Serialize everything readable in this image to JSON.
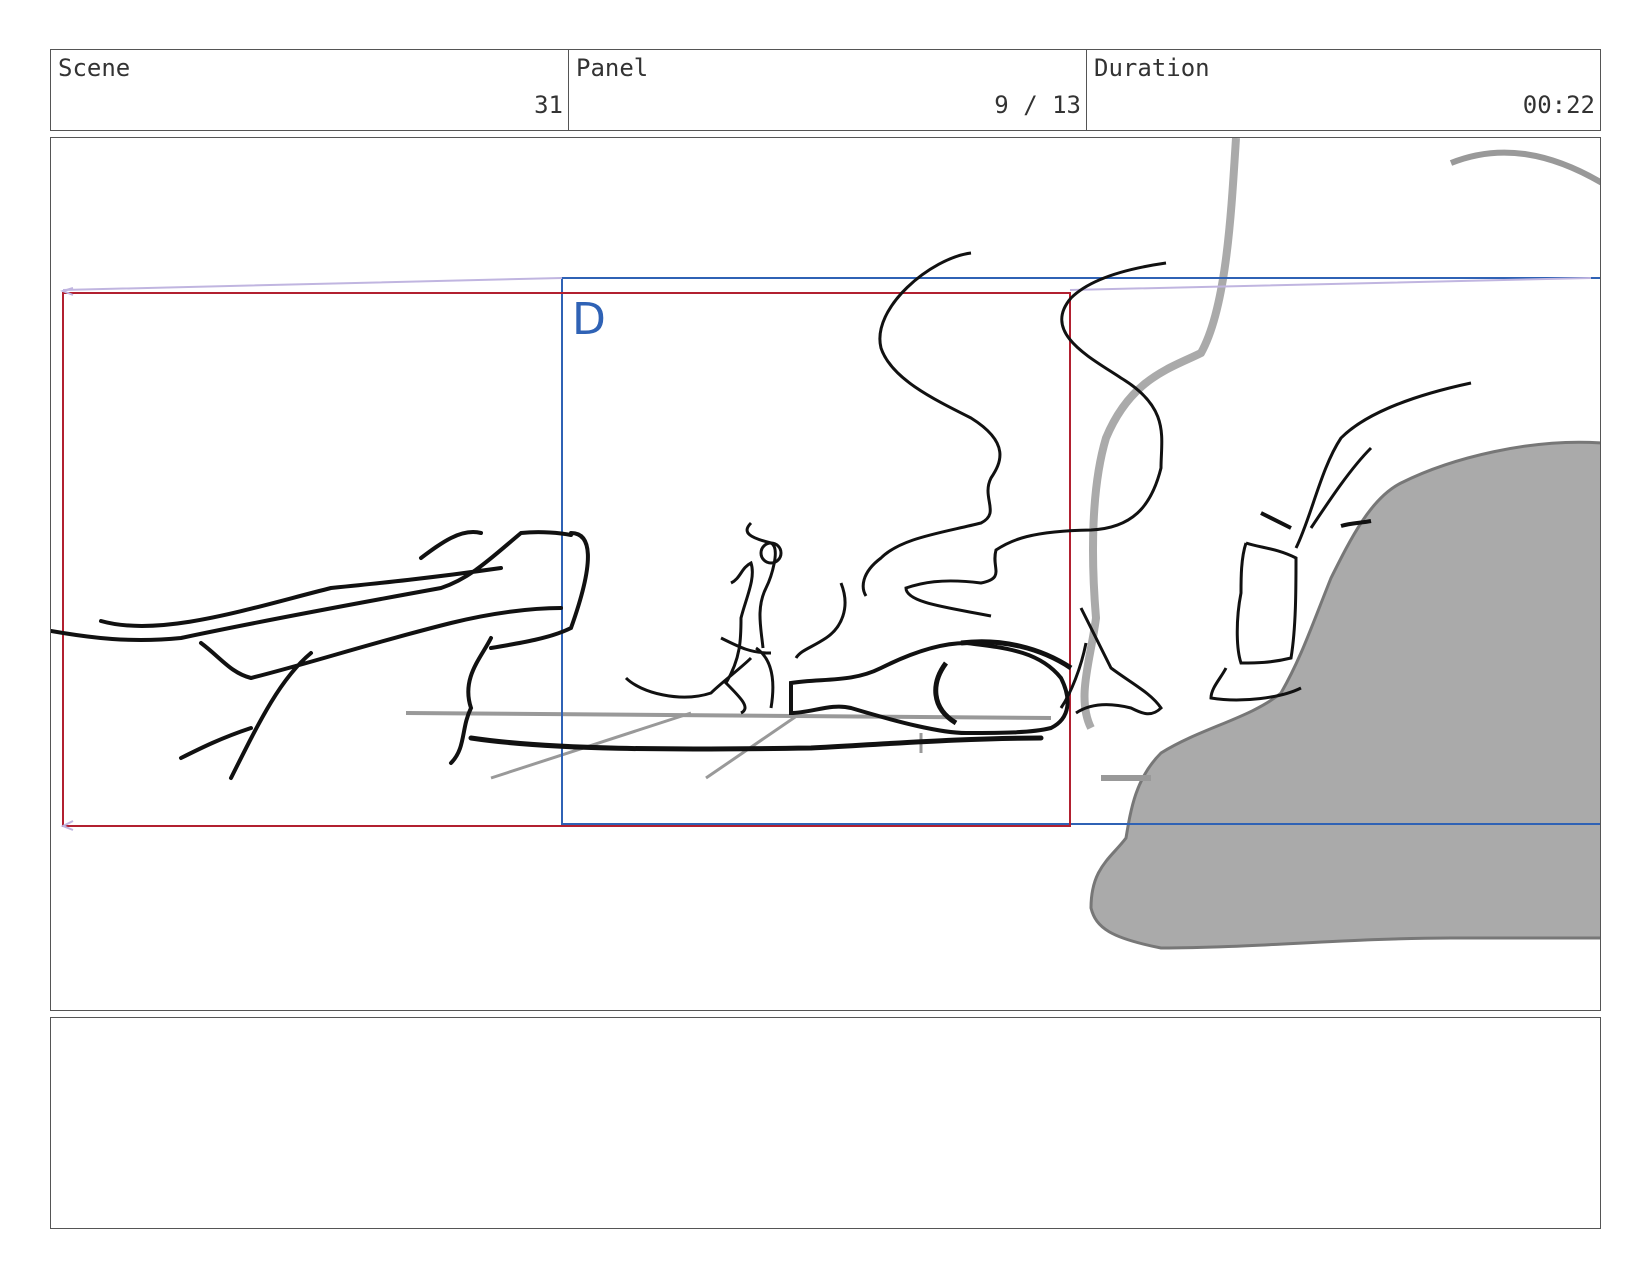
{
  "header": {
    "scene_label": "Scene",
    "scene_value": "31",
    "panel_label": "Panel",
    "panel_value": "9 / 13",
    "duration_label": "Duration",
    "duration_value": "00:22"
  },
  "frame": {
    "camera_label": "D"
  },
  "colors": {
    "border": "#555555",
    "camera_blue": "#2f62b5",
    "camera_red": "#b22030",
    "sketch_gray": "#a9a9a9"
  },
  "notes": {
    "text": ""
  }
}
